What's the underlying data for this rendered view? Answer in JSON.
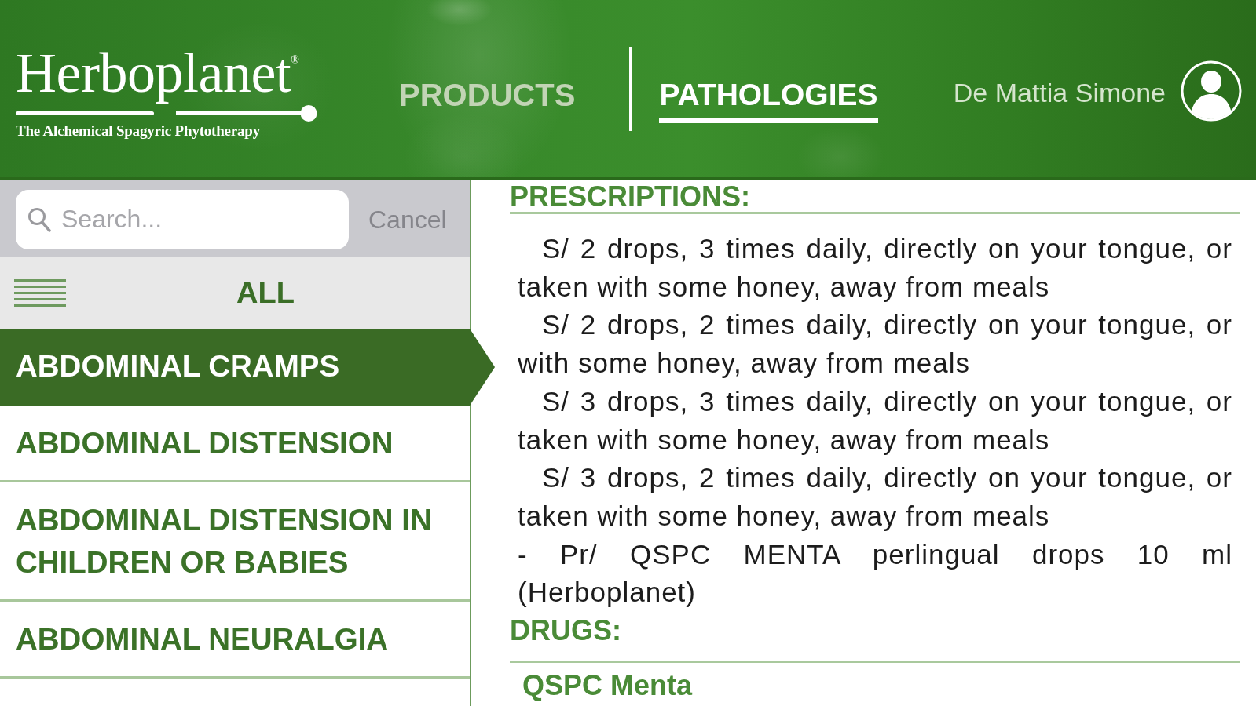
{
  "header": {
    "logo": {
      "name": "Herboplanet",
      "mark": "®",
      "tagline": "The Alchemical Spagyric Phytotherapy"
    },
    "tabs": [
      {
        "label": "PRODUCTS",
        "selected": false
      },
      {
        "label": "PATHOLOGIES",
        "selected": true
      }
    ],
    "user": {
      "name": "De Mattia Simone"
    }
  },
  "sidebar": {
    "search": {
      "placeholder": "Search...",
      "cancel": {
        "label": "Cancel",
        "disabled": true
      }
    },
    "filter": {
      "label": "ALL"
    },
    "items": [
      {
        "label": "ABDOMINAL CRAMPS",
        "selected": true
      },
      {
        "label": "ABDOMINAL DISTENSION",
        "selected": false
      },
      {
        "label": "ABDOMINAL DISTENSION IN CHILDREN OR BABIES",
        "selected": false
      },
      {
        "label": "ABDOMINAL NEURALGIA",
        "selected": false
      }
    ]
  },
  "content": {
    "sections": [
      {
        "title": "PRESCRIPTIONS:",
        "paragraphs": [
          {
            "kind": "dose",
            "text": "S/ 2 drops, 3 times daily, directly on your tongue, or taken with some honey, away from meals"
          },
          {
            "kind": "dose",
            "text": "S/ 2 drops, 2 times daily, directly on your tongue, or with some honey, away from meals"
          },
          {
            "kind": "dose",
            "text": "S/ 3 drops, 3 times daily, directly on your tongue, or taken with some honey, away from meals"
          },
          {
            "kind": "dose",
            "text": "S/ 3 drops, 2 times daily, directly on your tongue, or taken with some honey, away from meals"
          },
          {
            "kind": "product",
            "text": "- Pr/ QSPC MENTA perlingual drops 10 ml (Herboplanet)"
          }
        ]
      },
      {
        "title": "DRUGS:",
        "links": [
          "QSPC Menta"
        ]
      }
    ]
  }
}
